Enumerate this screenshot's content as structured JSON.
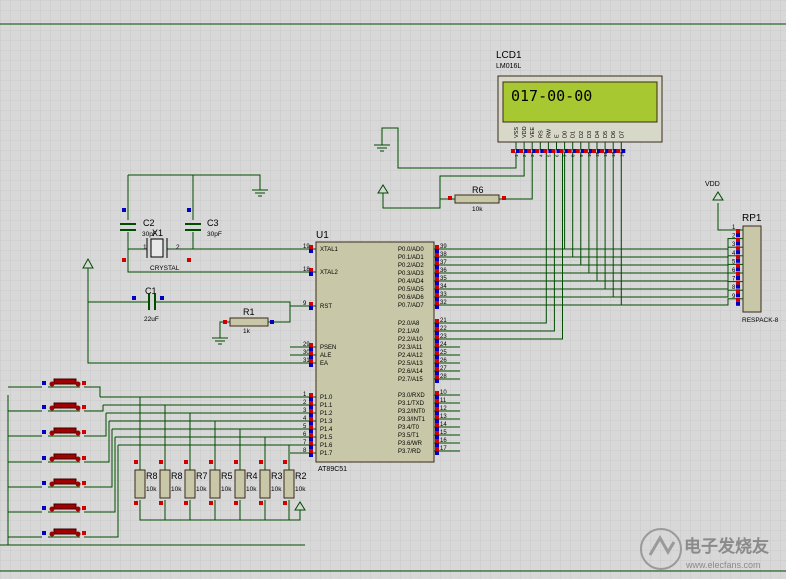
{
  "colors": {
    "background": "#d8d8d8",
    "grid": "#bcbcbc",
    "wire": "#004c00",
    "chip_fill": "#c8c8a8",
    "chip_border": "#3a2a1a",
    "lcd_bezel": "#d8d8c8",
    "lcd_screen": "#a8c832",
    "pin_red": "#d00000",
    "pin_blue": "#0000c0",
    "button": "#a00000",
    "text": "#000000"
  },
  "lcd": {
    "ref": "LCD1",
    "model": "LM016L",
    "display_text": "017-00-00",
    "pins": [
      "VSS",
      "VDD",
      "VEE",
      "RS",
      "RW",
      "E",
      "D0",
      "D1",
      "D2",
      "D3",
      "D4",
      "D5",
      "D6",
      "D7"
    ],
    "pin_numbers": [
      "1",
      "2",
      "3",
      "4",
      "5",
      "6",
      "7",
      "8",
      "9",
      "10",
      "11",
      "12",
      "13",
      "14"
    ]
  },
  "mcu": {
    "ref": "U1",
    "model": "AT89C51",
    "left_pins": [
      {
        "num": "19",
        "name": "XTAL1"
      },
      {
        "num": "18",
        "name": "XTAL2"
      },
      {
        "num": "9",
        "name": "RST"
      },
      {
        "num": "29",
        "name": "PSEN"
      },
      {
        "num": "30",
        "name": "ALE"
      },
      {
        "num": "31",
        "name": "EA"
      },
      {
        "num": "1",
        "name": "P1.0"
      },
      {
        "num": "2",
        "name": "P1.1"
      },
      {
        "num": "3",
        "name": "P1.2"
      },
      {
        "num": "4",
        "name": "P1.3"
      },
      {
        "num": "5",
        "name": "P1.4"
      },
      {
        "num": "6",
        "name": "P1.5"
      },
      {
        "num": "7",
        "name": "P1.6"
      },
      {
        "num": "8",
        "name": "P1.7"
      }
    ],
    "right_p0": [
      {
        "num": "39",
        "name": "P0.0/AD0"
      },
      {
        "num": "38",
        "name": "P0.1/AD1"
      },
      {
        "num": "37",
        "name": "P0.2/AD2"
      },
      {
        "num": "36",
        "name": "P0.3/AD3"
      },
      {
        "num": "35",
        "name": "P0.4/AD4"
      },
      {
        "num": "34",
        "name": "P0.5/AD5"
      },
      {
        "num": "33",
        "name": "P0.6/AD6"
      },
      {
        "num": "32",
        "name": "P0.7/AD7"
      }
    ],
    "right_p2": [
      {
        "num": "21",
        "name": "P2.0/A8"
      },
      {
        "num": "22",
        "name": "P2.1/A9"
      },
      {
        "num": "23",
        "name": "P2.2/A10"
      },
      {
        "num": "24",
        "name": "P2.3/A11"
      },
      {
        "num": "25",
        "name": "P2.4/A12"
      },
      {
        "num": "26",
        "name": "P2.5/A13"
      },
      {
        "num": "27",
        "name": "P2.6/A14"
      },
      {
        "num": "28",
        "name": "P2.7/A15"
      }
    ],
    "right_p3": [
      {
        "num": "10",
        "name": "P3.0/RXD"
      },
      {
        "num": "11",
        "name": "P3.1/TXD"
      },
      {
        "num": "12",
        "name": "P3.2/INT0"
      },
      {
        "num": "13",
        "name": "P3.3/INT1"
      },
      {
        "num": "14",
        "name": "P3.4/T0"
      },
      {
        "num": "15",
        "name": "P3.5/T1"
      },
      {
        "num": "16",
        "name": "P3.6/WR"
      },
      {
        "num": "17",
        "name": "P3.7/RD"
      }
    ]
  },
  "rp1": {
    "ref": "RP1",
    "model": "RESPACK-8",
    "pins": [
      "1",
      "2",
      "3",
      "4",
      "5",
      "6",
      "7",
      "8",
      "9"
    ]
  },
  "vdd_label": "VDD",
  "c2": {
    "ref": "C2",
    "value": "30pF"
  },
  "c3": {
    "ref": "C3",
    "value": "30pF"
  },
  "x1": {
    "ref": "X1",
    "value": "CRYSTAL",
    "pin1": "1",
    "pin2": "2"
  },
  "c1": {
    "ref": "C1",
    "value": "22uF"
  },
  "r1": {
    "ref": "R1",
    "value": "1k"
  },
  "r6": {
    "ref": "R6",
    "value": "10k"
  },
  "pulldowns": [
    {
      "ref": "R8",
      "value": "10k"
    },
    {
      "ref": "R8",
      "value": "10k"
    },
    {
      "ref": "R7",
      "value": "10k"
    },
    {
      "ref": "R5",
      "value": "10k"
    },
    {
      "ref": "R4",
      "value": "10k"
    },
    {
      "ref": "R3",
      "value": "10k"
    },
    {
      "ref": "R2",
      "value": "10k"
    }
  ],
  "watermark": {
    "cn": "电子发烧友",
    "url": "www.elecfans.com"
  }
}
